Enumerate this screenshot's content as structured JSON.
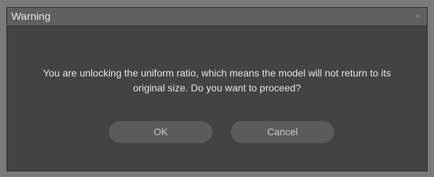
{
  "dialog": {
    "title": "Warning",
    "close_icon": "×",
    "message_line1": "You are unlocking the uniform ratio, which means the model will not return to its",
    "message_line2": "original size. Do you want to proceed?",
    "ok_label": "OK",
    "cancel_label": "Cancel"
  }
}
